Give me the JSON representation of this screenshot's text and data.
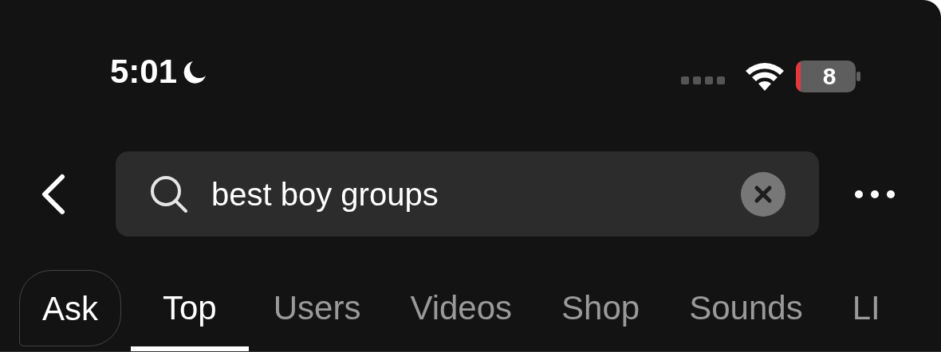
{
  "status_bar": {
    "time": "5:01",
    "battery": "8"
  },
  "search": {
    "value": "best boy groups"
  },
  "ask_button": {
    "label": "Ask"
  },
  "tabs": [
    {
      "label": "Top",
      "selected": true
    },
    {
      "label": "Users",
      "selected": false
    },
    {
      "label": "Videos",
      "selected": false
    },
    {
      "label": "Shop",
      "selected": false
    },
    {
      "label": "Sounds",
      "selected": false
    },
    {
      "label": "LI",
      "selected": false
    }
  ]
}
